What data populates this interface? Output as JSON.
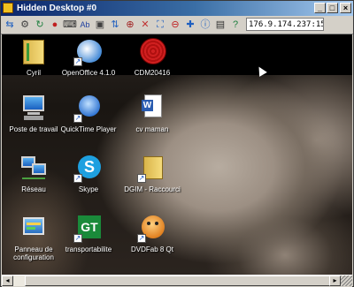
{
  "window": {
    "title": "Hidden Desktop #0"
  },
  "toolbar": {
    "tools": [
      "connection-icon",
      "options-icon",
      "refresh-icon",
      "record-icon",
      "keyboard-icon",
      "text-icon",
      "screenshot-icon",
      "transfer-icon",
      "zoom-icon",
      "ctrl-alt-del-icon",
      "fullscreen-icon",
      "disconnect-icon",
      "settings-icon",
      "info-icon",
      "monitor-icon",
      "help-icon"
    ],
    "address_value": "176.9.174.237:1555"
  },
  "titlebar": {
    "minimize": "_",
    "maximize": "□",
    "close": "×"
  },
  "desktop": {
    "icons": [
      {
        "label": "Cyril",
        "icon": "folder-icon"
      },
      {
        "label": "OpenOffice 4.1.0",
        "icon": "openoffice-icon"
      },
      {
        "label": "CDM20416",
        "icon": "cdm-icon"
      },
      {
        "label": "Poste de travail",
        "icon": "computer-icon"
      },
      {
        "label": "QuickTime Player",
        "icon": "quicktime-icon"
      },
      {
        "label": "cv maman",
        "icon": "word-document-icon"
      },
      {
        "label": "Réseau",
        "icon": "network-icon"
      },
      {
        "label": "Skype",
        "icon": "skype-icon"
      },
      {
        "label": "DGIM - Raccourci",
        "icon": "folder-shortcut-icon"
      },
      {
        "label": "Panneau de configuration",
        "icon": "control-panel-icon"
      },
      {
        "label": "transportabilite",
        "icon": "transport-icon"
      },
      {
        "label": "DVDFab 8 Qt",
        "icon": "dvdfab-icon"
      }
    ]
  },
  "colors": {
    "titlebar_start": "#0a246a",
    "titlebar_end": "#a6caf0",
    "chrome": "#d4d0c8"
  }
}
